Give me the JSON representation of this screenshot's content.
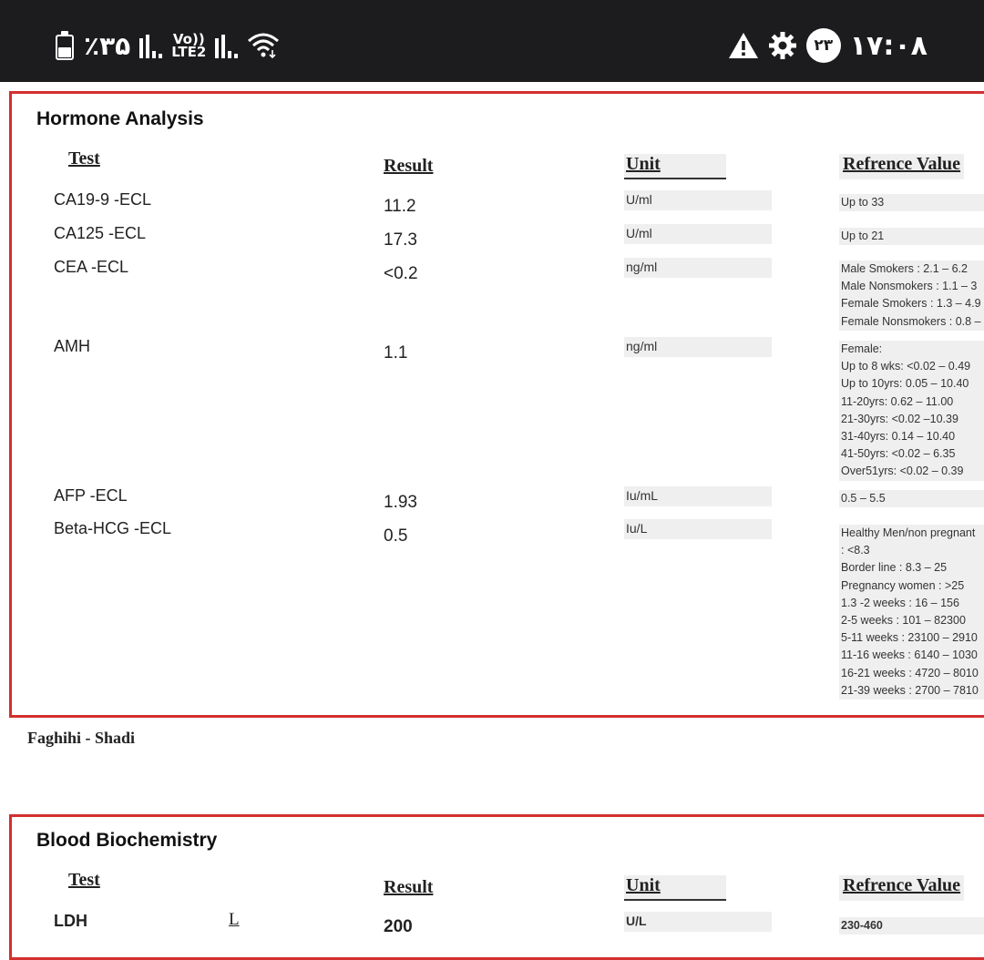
{
  "status_bar": {
    "battery_percent": "٪۳۵",
    "lte_top": "Vo))",
    "lte_bottom": "LTE2",
    "notification_count": "۲۳",
    "time": "۱۷:۰۸",
    "icons": [
      "battery-icon",
      "signal-icon",
      "lte-icon",
      "signal-icon",
      "wifi-icon",
      "warning-icon",
      "gear-icon"
    ]
  },
  "hormone": {
    "title": "Hormone Analysis",
    "headers": {
      "test": "Test",
      "result": "Result",
      "unit": "Unit",
      "reference": "Refrence Value"
    },
    "rows": [
      {
        "test": "CA19-9 -ECL",
        "result": "11.2",
        "unit": "U/ml",
        "reference": [
          "Up to 33"
        ]
      },
      {
        "test": "CA125 -ECL",
        "result": "17.3",
        "unit": "U/ml",
        "reference": [
          "Up to 21"
        ]
      },
      {
        "test": "CEA -ECL",
        "result": "<0.2",
        "unit": "ng/ml",
        "reference": [
          "Male Smokers : 2.1 – 6.2",
          "Male Nonsmokers : 1.1 – 3",
          "Female Smokers : 1.3 – 4.9",
          "Female Nonsmokers : 0.8 –"
        ]
      },
      {
        "test": "AMH",
        "result": "1.1",
        "unit": "ng/ml",
        "reference": [
          "Female:",
          "Up to 8 wks: <0.02 – 0.49",
          "Up to 10yrs: 0.05 – 10.40",
          "11-20yrs: 0.62 – 11.00",
          "21-30yrs: <0.02 –10.39",
          "31-40yrs: 0.14 – 10.40",
          "41-50yrs: <0.02 – 6.35",
          "Over51yrs: <0.02 – 0.39"
        ]
      },
      {
        "test": "AFP -ECL",
        "result": "1.93",
        "unit": "Iu/mL",
        "reference": [
          "0.5 – 5.5"
        ]
      },
      {
        "test": "Beta-HCG -ECL",
        "result": "0.5",
        "unit": "Iu/L",
        "reference": [
          "Healthy Men/non pregnant",
          ": <8.3",
          "Border line : 8.3 – 25",
          "Pregnancy women : >25",
          "1.3 -2 weeks : 16 – 156",
          "2-5 weeks : 101 – 82300",
          "5-11 weeks : 23100 – 2910",
          "11-16 weeks : 6140 – 1030",
          "16-21 weeks : 4720 – 8010",
          "21-39 weeks : 2700 – 7810"
        ]
      }
    ]
  },
  "signature": "Faghihi - Shadi",
  "biochem": {
    "title": "Blood Biochemistry",
    "headers": {
      "test": "Test",
      "result": "Result",
      "unit": "Unit",
      "reference": "Refrence Value"
    },
    "rows": [
      {
        "test": "LDH",
        "flag": "L",
        "result": "200",
        "unit": "U/L",
        "reference": [
          "230-460"
        ]
      }
    ]
  }
}
